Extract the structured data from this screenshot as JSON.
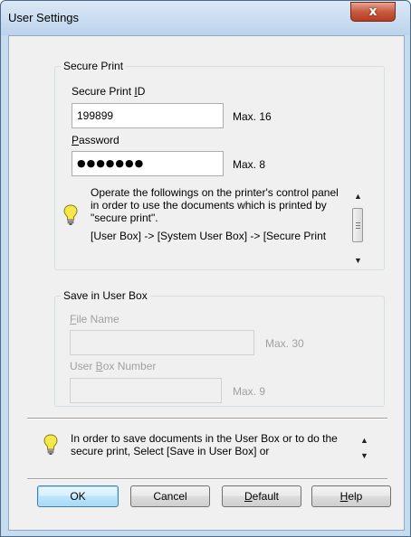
{
  "window": {
    "title": "User Settings",
    "close_glyph": "x"
  },
  "secure_print": {
    "legend": "Secure Print",
    "id_label_prefix": "Secure Print ",
    "id_label_mnemonic": "I",
    "id_label_suffix": "D",
    "id_value": "199899",
    "id_max": "Max. 16",
    "password_label_mnemonic": "P",
    "password_label_suffix": "assword",
    "password_masked": "●●●●●●●",
    "password_max": "Max. 8",
    "hint_icon": "lightbulb-icon",
    "hint_paragraph_1": "Operate the followings on the printer's control panel in order to use the documents which is printed by \"secure print\".",
    "hint_paragraph_2": "[User Box] -> [System User Box] -> [Secure Print"
  },
  "save_in_user_box": {
    "legend": "Save in User Box",
    "file_name_label_mnemonic": "F",
    "file_name_label_suffix": "ile Name",
    "file_name_value": "",
    "file_name_max": "Max. 30",
    "box_number_label_prefix": "User ",
    "box_number_label_mnemonic": "B",
    "box_number_label_suffix": "ox Number",
    "box_number_value": "",
    "box_number_max": "Max. 9"
  },
  "bottom_hint": {
    "icon": "lightbulb-icon",
    "text": "In order to save documents in the User Box or to do the secure print, Select [Save in User Box] or"
  },
  "buttons": {
    "ok": "OK",
    "cancel": "Cancel",
    "default_mnemonic": "D",
    "default_suffix": "efault",
    "help_mnemonic": "H",
    "help_suffix": "elp"
  },
  "colors": {
    "title_bar": "#c7dbef",
    "close_button": "#c75a3f",
    "dialog_background": "#f0f0f0",
    "lightbulb_fill": "#f6e84a"
  }
}
